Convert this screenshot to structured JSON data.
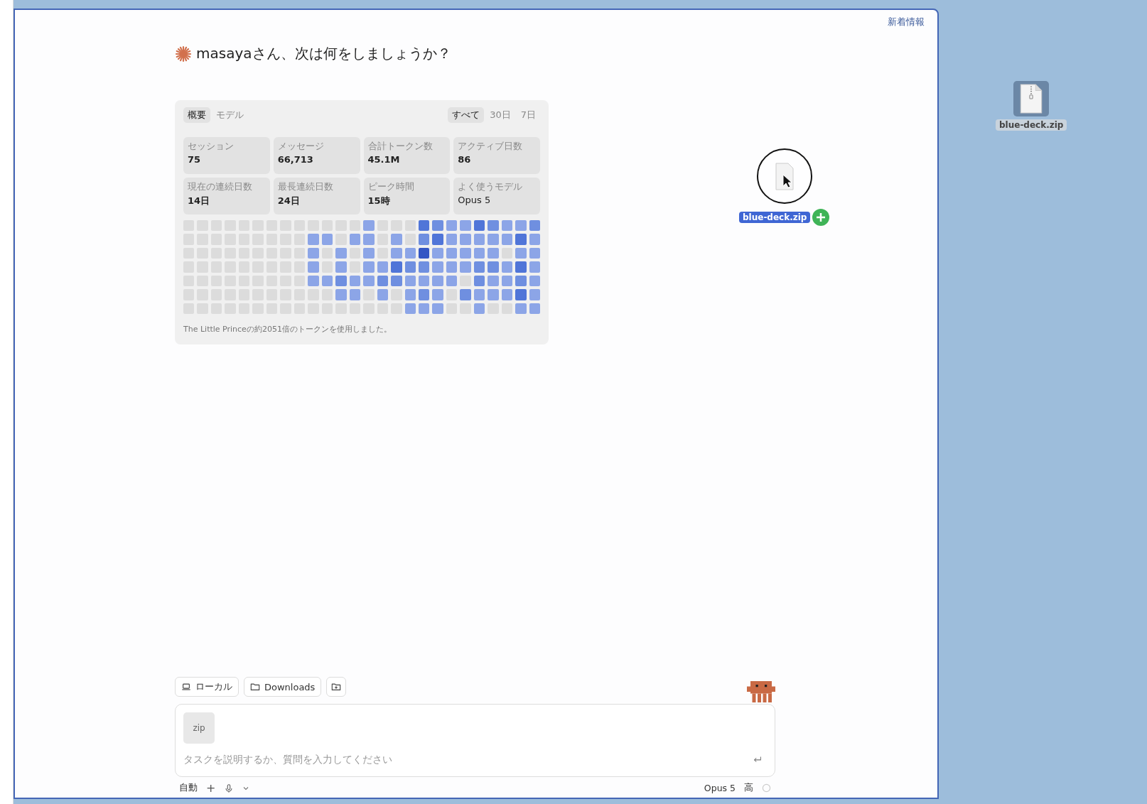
{
  "header": {
    "whats_new": "新着情報"
  },
  "greeting": "masayaさん、次は何をしましょうか？",
  "stats_card": {
    "view_tabs": [
      {
        "label": "概要",
        "selected": true
      },
      {
        "label": "モデル",
        "selected": false
      }
    ],
    "range_tabs": [
      {
        "label": "すべて",
        "selected": true
      },
      {
        "label": "30日",
        "selected": false
      },
      {
        "label": "7日",
        "selected": false
      }
    ],
    "stats": [
      {
        "label": "セッション",
        "value": "75",
        "emphasis": true
      },
      {
        "label": "メッセージ",
        "value": "66,713",
        "emphasis": true
      },
      {
        "label": "合計トークン数",
        "value": "45.1M",
        "emphasis": true
      },
      {
        "label": "アクティブ日数",
        "value": "86",
        "emphasis": true
      },
      {
        "label": "現在の連続日数",
        "value": "14日",
        "emphasis": true
      },
      {
        "label": "最長連続日数",
        "value": "24日",
        "emphasis": true
      },
      {
        "label": "ピーク時間",
        "value": "15時",
        "emphasis": true
      },
      {
        "label": "よく使うモデル",
        "value": "Opus 5",
        "emphasis": false
      }
    ],
    "activity_rows": [
      {
        "cells": [
          {
            "color": "#dcdcdc"
          },
          {
            "color": "#dcdcdc"
          },
          {
            "color": "#dcdcdc"
          },
          {
            "color": "#dcdcdc"
          },
          {
            "color": "#dcdcdc"
          },
          {
            "color": "#dcdcdc"
          },
          {
            "color": "#dcdcdc"
          },
          {
            "color": "#dcdcdc"
          },
          {
            "color": "#dcdcdc"
          },
          {
            "color": "#dcdcdc"
          },
          {
            "color": "#dcdcdc"
          },
          {
            "color": "#dcdcdc"
          },
          {
            "color": "#dcdcdc"
          },
          {
            "color": "#8ca5e7"
          },
          {
            "color": "#dcdcdc"
          },
          {
            "color": "#dcdcdc"
          },
          {
            "color": "#dcdcdc"
          },
          {
            "color": "#5075d8"
          },
          {
            "color": "#6f8fe0"
          },
          {
            "color": "#8ca5e7"
          },
          {
            "color": "#8ca5e7"
          },
          {
            "color": "#5075d8"
          },
          {
            "color": "#6f8fe0"
          },
          {
            "color": "#8ca5e7"
          },
          {
            "color": "#8ca5e7"
          },
          {
            "color": "#6f8fe0"
          }
        ]
      },
      {
        "cells": [
          {
            "color": "#dcdcdc"
          },
          {
            "color": "#dcdcdc"
          },
          {
            "color": "#dcdcdc"
          },
          {
            "color": "#dcdcdc"
          },
          {
            "color": "#dcdcdc"
          },
          {
            "color": "#dcdcdc"
          },
          {
            "color": "#dcdcdc"
          },
          {
            "color": "#dcdcdc"
          },
          {
            "color": "#dcdcdc"
          },
          {
            "color": "#8ca5e7"
          },
          {
            "color": "#8ca5e7"
          },
          {
            "color": "#dcdcdc"
          },
          {
            "color": "#8ca5e7"
          },
          {
            "color": "#8ca5e7"
          },
          {
            "color": "#dcdcdc"
          },
          {
            "color": "#8ca5e7"
          },
          {
            "color": "#dcdcdc"
          },
          {
            "color": "#6f8fe0"
          },
          {
            "color": "#5075d8"
          },
          {
            "color": "#8ca5e7"
          },
          {
            "color": "#8ca5e7"
          },
          {
            "color": "#8ca5e7"
          },
          {
            "color": "#8ca5e7"
          },
          {
            "color": "#8ca5e7"
          },
          {
            "color": "#5075d8"
          },
          {
            "color": "#8ca5e7"
          }
        ]
      },
      {
        "cells": [
          {
            "color": "#dcdcdc"
          },
          {
            "color": "#dcdcdc"
          },
          {
            "color": "#dcdcdc"
          },
          {
            "color": "#dcdcdc"
          },
          {
            "color": "#dcdcdc"
          },
          {
            "color": "#dcdcdc"
          },
          {
            "color": "#dcdcdc"
          },
          {
            "color": "#dcdcdc"
          },
          {
            "color": "#dcdcdc"
          },
          {
            "color": "#8ca5e7"
          },
          {
            "color": "#dcdcdc"
          },
          {
            "color": "#8ca5e7"
          },
          {
            "color": "#dcdcdc"
          },
          {
            "color": "#8ca5e7"
          },
          {
            "color": "#dcdcdc"
          },
          {
            "color": "#8ca5e7"
          },
          {
            "color": "#8ca5e7"
          },
          {
            "color": "#3456c4"
          },
          {
            "color": "#8ca5e7"
          },
          {
            "color": "#8ca5e7"
          },
          {
            "color": "#8ca5e7"
          },
          {
            "color": "#8ca5e7"
          },
          {
            "color": "#8ca5e7"
          },
          {
            "color": "#dcdcdc"
          },
          {
            "color": "#8ca5e7"
          },
          {
            "color": "#8ca5e7"
          }
        ]
      },
      {
        "cells": [
          {
            "color": "#dcdcdc"
          },
          {
            "color": "#dcdcdc"
          },
          {
            "color": "#dcdcdc"
          },
          {
            "color": "#dcdcdc"
          },
          {
            "color": "#dcdcdc"
          },
          {
            "color": "#dcdcdc"
          },
          {
            "color": "#dcdcdc"
          },
          {
            "color": "#dcdcdc"
          },
          {
            "color": "#dcdcdc"
          },
          {
            "color": "#8ca5e7"
          },
          {
            "color": "#dcdcdc"
          },
          {
            "color": "#8ca5e7"
          },
          {
            "color": "#dcdcdc"
          },
          {
            "color": "#8ca5e7"
          },
          {
            "color": "#8ca5e7"
          },
          {
            "color": "#5075d8"
          },
          {
            "color": "#6f8fe0"
          },
          {
            "color": "#6f8fe0"
          },
          {
            "color": "#8ca5e7"
          },
          {
            "color": "#8ca5e7"
          },
          {
            "color": "#8ca5e7"
          },
          {
            "color": "#6f8fe0"
          },
          {
            "color": "#6f8fe0"
          },
          {
            "color": "#8ca5e7"
          },
          {
            "color": "#5075d8"
          },
          {
            "color": "#8ca5e7"
          }
        ]
      },
      {
        "cells": [
          {
            "color": "#dcdcdc"
          },
          {
            "color": "#dcdcdc"
          },
          {
            "color": "#dcdcdc"
          },
          {
            "color": "#dcdcdc"
          },
          {
            "color": "#dcdcdc"
          },
          {
            "color": "#dcdcdc"
          },
          {
            "color": "#dcdcdc"
          },
          {
            "color": "#dcdcdc"
          },
          {
            "color": "#dcdcdc"
          },
          {
            "color": "#8ca5e7"
          },
          {
            "color": "#8ca5e7"
          },
          {
            "color": "#6f8fe0"
          },
          {
            "color": "#8ca5e7"
          },
          {
            "color": "#8ca5e7"
          },
          {
            "color": "#6f8fe0"
          },
          {
            "color": "#6f8fe0"
          },
          {
            "color": "#8ca5e7"
          },
          {
            "color": "#8ca5e7"
          },
          {
            "color": "#8ca5e7"
          },
          {
            "color": "#8ca5e7"
          },
          {
            "color": "#dcdcdc"
          },
          {
            "color": "#6f8fe0"
          },
          {
            "color": "#8ca5e7"
          },
          {
            "color": "#8ca5e7"
          },
          {
            "color": "#6f8fe0"
          },
          {
            "color": "#8ca5e7"
          }
        ]
      },
      {
        "cells": [
          {
            "color": "#dcdcdc"
          },
          {
            "color": "#dcdcdc"
          },
          {
            "color": "#dcdcdc"
          },
          {
            "color": "#dcdcdc"
          },
          {
            "color": "#dcdcdc"
          },
          {
            "color": "#dcdcdc"
          },
          {
            "color": "#dcdcdc"
          },
          {
            "color": "#dcdcdc"
          },
          {
            "color": "#dcdcdc"
          },
          {
            "color": "#dcdcdc"
          },
          {
            "color": "#dcdcdc"
          },
          {
            "color": "#8ca5e7"
          },
          {
            "color": "#8ca5e7"
          },
          {
            "color": "#dcdcdc"
          },
          {
            "color": "#8ca5e7"
          },
          {
            "color": "#dcdcdc"
          },
          {
            "color": "#8ca5e7"
          },
          {
            "color": "#6f8fe0"
          },
          {
            "color": "#8ca5e7"
          },
          {
            "color": "#dcdcdc"
          },
          {
            "color": "#6f8fe0"
          },
          {
            "color": "#8ca5e7"
          },
          {
            "color": "#8ca5e7"
          },
          {
            "color": "#8ca5e7"
          },
          {
            "color": "#5075d8"
          },
          {
            "color": "#8ca5e7"
          }
        ]
      },
      {
        "cells": [
          {
            "color": "#dcdcdc"
          },
          {
            "color": "#dcdcdc"
          },
          {
            "color": "#dcdcdc"
          },
          {
            "color": "#dcdcdc"
          },
          {
            "color": "#dcdcdc"
          },
          {
            "color": "#dcdcdc"
          },
          {
            "color": "#dcdcdc"
          },
          {
            "color": "#dcdcdc"
          },
          {
            "color": "#dcdcdc"
          },
          {
            "color": "#dcdcdc"
          },
          {
            "color": "#dcdcdc"
          },
          {
            "color": "#dcdcdc"
          },
          {
            "color": "#dcdcdc"
          },
          {
            "color": "#dcdcdc"
          },
          {
            "color": "#dcdcdc"
          },
          {
            "color": "#dcdcdc"
          },
          {
            "color": "#8ca5e7"
          },
          {
            "color": "#8ca5e7"
          },
          {
            "color": "#8ca5e7"
          },
          {
            "color": "#dcdcdc"
          },
          {
            "color": "#dcdcdc"
          },
          {
            "color": "#8ca5e7"
          },
          {
            "color": "#dcdcdc"
          },
          {
            "color": "#dcdcdc"
          },
          {
            "color": "#8ca5e7"
          },
          {
            "color": "#8ca5e7"
          }
        ]
      }
    ],
    "footnote": "The Little Princeの約2051倍のトークンを使用しました。"
  },
  "composer": {
    "chips": [
      {
        "kind": "local",
        "label": "ローカル"
      },
      {
        "kind": "folder",
        "label": "Downloads"
      },
      {
        "kind": "add-folder"
      }
    ],
    "attachment": "zip",
    "placeholder": "タスクを説明するか、質問を入力してください",
    "mode": "自動",
    "add": "+",
    "model": "Opus 5",
    "effort": "高"
  },
  "drag": {
    "label": "blue-deck.zip"
  },
  "desktop_icon": {
    "label": "blue-deck.zip",
    "selected": true
  }
}
